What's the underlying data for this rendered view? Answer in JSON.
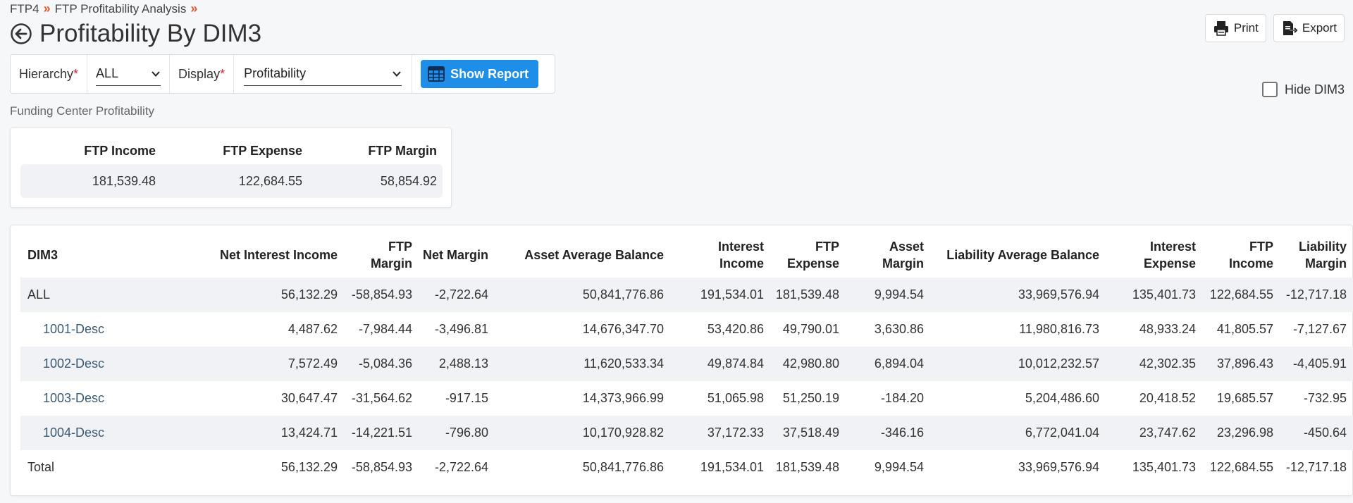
{
  "breadcrumb": {
    "items": [
      "FTP4",
      "FTP Profitability Analysis"
    ],
    "separator": "»"
  },
  "page_title": "Profitability By DIM3",
  "actions": {
    "print": "Print",
    "export": "Export"
  },
  "filters": {
    "hierarchy_label": "Hierarchy",
    "hierarchy_value": "ALL",
    "display_label": "Display",
    "display_value": "Profitability",
    "required_mark": "*",
    "show_report": "Show Report"
  },
  "hide_dim_label": "Hide DIM3",
  "funding_center": {
    "label": "Funding Center Profitability",
    "headers": [
      "FTP Income",
      "FTP Expense",
      "FTP Margin"
    ],
    "values": [
      "181,539.48",
      "122,684.55",
      "58,854.92"
    ]
  },
  "table": {
    "headers": [
      "DIM3",
      "Net Interest Income",
      "FTP Margin",
      "Net Margin",
      "Asset Average Balance",
      "Interest Income",
      "FTP Expense",
      "Asset Margin",
      "Liability Average Balance",
      "Interest Expense",
      "FTP Income",
      "Liability Margin"
    ],
    "rows": [
      [
        "ALL",
        "56,132.29",
        "-58,854.93",
        "-2,722.64",
        "50,841,776.86",
        "191,534.01",
        "181,539.48",
        "9,994.54",
        "33,969,576.94",
        "135,401.73",
        "122,684.55",
        "-12,717.18"
      ],
      [
        "1001-Desc",
        "4,487.62",
        "-7,984.44",
        "-3,496.81",
        "14,676,347.70",
        "53,420.86",
        "49,790.01",
        "3,630.86",
        "11,980,816.73",
        "48,933.24",
        "41,805.57",
        "-7,127.67"
      ],
      [
        "1002-Desc",
        "7,572.49",
        "-5,084.36",
        "2,488.13",
        "11,620,533.34",
        "49,874.84",
        "42,980.80",
        "6,894.04",
        "10,012,232.57",
        "42,302.35",
        "37,896.43",
        "-4,405.91"
      ],
      [
        "1003-Desc",
        "30,647.47",
        "-31,564.62",
        "-917.15",
        "14,373,966.99",
        "51,065.98",
        "51,250.19",
        "-184.20",
        "5,204,486.60",
        "20,418.52",
        "19,685.57",
        "-732.95"
      ],
      [
        "1004-Desc",
        "13,424.71",
        "-14,221.51",
        "-796.80",
        "10,170,928.82",
        "37,172.33",
        "37,518.49",
        "-346.16",
        "6,772,041.04",
        "23,747.62",
        "23,296.98",
        "-450.64"
      ],
      [
        "Total",
        "56,132.29",
        "-58,854.93",
        "-2,722.64",
        "50,841,776.86",
        "191,534.01",
        "181,539.48",
        "9,994.54",
        "33,969,576.94",
        "135,401.73",
        "122,684.55",
        "-12,717.18"
      ]
    ]
  },
  "colors": {
    "accent": "#1e8ee8",
    "breadcrumb_sep": "#e4572e",
    "required": "#d9253a"
  }
}
